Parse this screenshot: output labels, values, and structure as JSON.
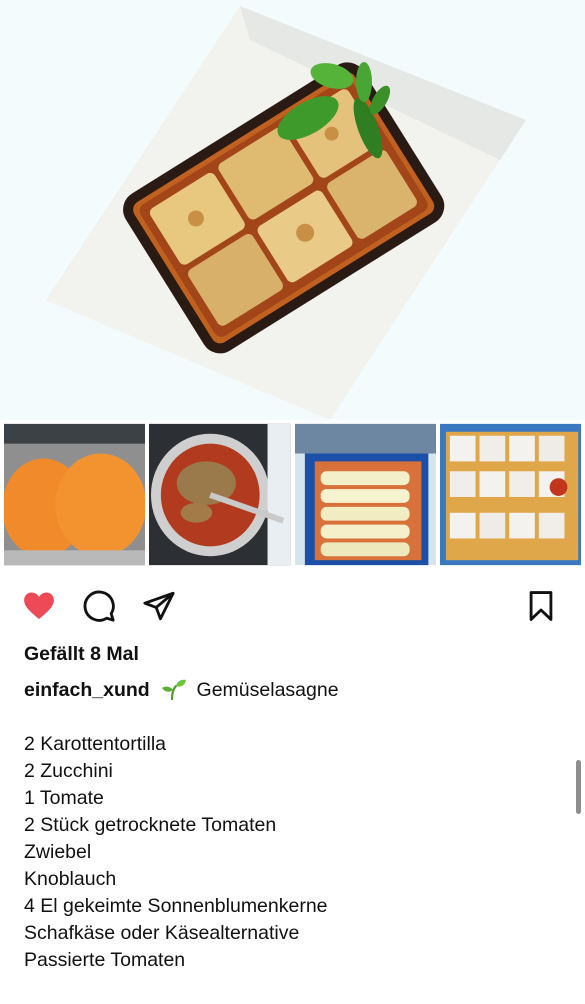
{
  "post": {
    "likes_text": "Gefällt 8 Mal",
    "username": "einfach_xund",
    "caption_title": "Gemüselasagne",
    "ingredients": [
      "2 Karottentortilla",
      "2 Zucchini",
      "1 Tomate",
      "2 Stück getrocknete Tomaten",
      "Zwiebel",
      "Knoblauch",
      "4 El gekeimte Sonnenblumenkerne",
      "Schafkäse oder Käsealternative",
      "Passierte Tomaten"
    ]
  },
  "icons": {
    "like": "heart-icon",
    "comment": "comment-icon",
    "share": "send-icon",
    "save": "bookmark-icon",
    "emoji": "seedling-emoji"
  },
  "colors": {
    "like_active": "#ed4956",
    "text": "#111111",
    "hero_background": "#f4fbfd"
  }
}
